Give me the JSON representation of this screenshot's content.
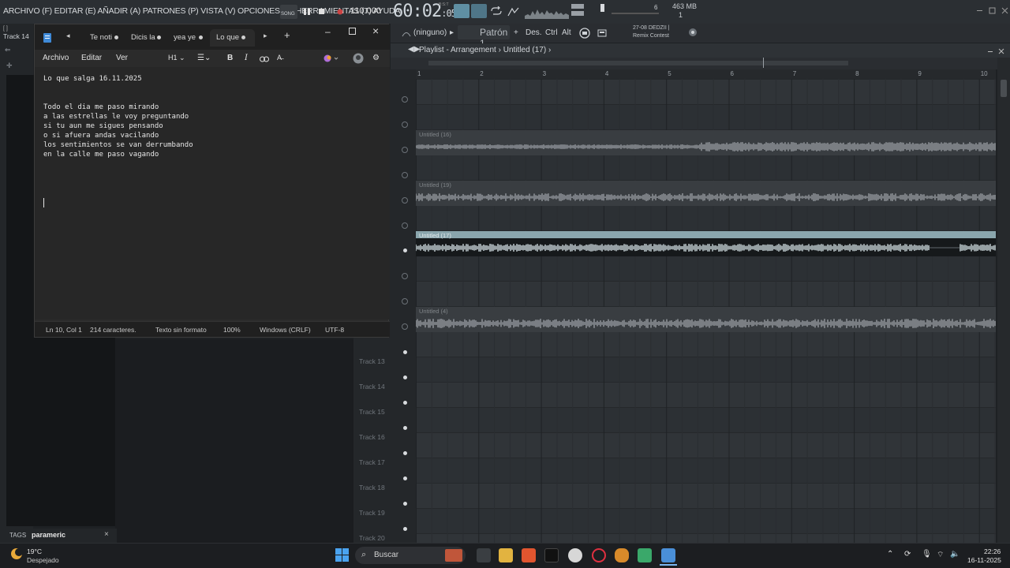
{
  "fl": {
    "menu": "ARCHIVO (F) EDITAR (E) AÑADIR (A) PATRONES (P) VISTA (V) OPCIONES (O) HERRAMIENTAS (T) AYUDA",
    "tempo": "110.000",
    "time_main": "60:02",
    "time_sub": ":05",
    "time_mode": "B:S:T",
    "song_label": "SONG",
    "mem": "463 MB",
    "cpu_num": "6",
    "voices": "1",
    "pattern_none": "(ninguno)",
    "pattern": "Patrón 1",
    "snap_des": "Des.",
    "key_ctrl": "Ctrl",
    "key_alt": "Alt",
    "news": "27-08  DEDZII | Remix Contest",
    "playlist_title": "Playlist - Arrangement",
    "playlist_sub": "Untitled (17)",
    "track14_header": "Track 14",
    "ruler": [
      "1",
      "2",
      "3",
      "4",
      "5",
      "6",
      "7",
      "8",
      "9",
      "10"
    ],
    "clips": [
      {
        "title": "Untitled (16)"
      },
      {
        "title": "Untitled (19)"
      },
      {
        "title": "Untitled (17)"
      },
      {
        "title": "Untitled (4)"
      }
    ],
    "tracks": [
      "Track 13",
      "Track 14",
      "Track 15",
      "Track 16",
      "Track 17",
      "Track 18",
      "Track 19",
      "Track 20"
    ],
    "tags_label": "TAGS",
    "tags_value": "parameric"
  },
  "notepad": {
    "tabs": [
      {
        "label": "Te noti"
      },
      {
        "label": "Dicis la"
      },
      {
        "label": "yea ye"
      },
      {
        "label": "Lo que"
      }
    ],
    "menu": [
      "Archivo",
      "Editar",
      "Ver"
    ],
    "heading_btn": "H1",
    "lines": [
      "Lo que salga 16.11.2025",
      "",
      "Todo el dia me paso mirando",
      "a las estrellas le voy preguntando",
      "si tu aun me sigues pensando",
      "o si afuera andas vacilando",
      "los sentimientos se van derrumbando",
      "en la calle me paso vagando"
    ],
    "status": {
      "position": "Ln 10, Col 1",
      "chars": "214 caracteres.",
      "format": "Texto sin formato",
      "zoom": "100%",
      "eol": "Windows (CRLF)",
      "encoding": "UTF-8"
    }
  },
  "taskbar": {
    "weather_temp": "19°C",
    "weather_desc": "Despejado",
    "search": "Buscar",
    "time": "22:26",
    "date": "16-11-2025"
  }
}
